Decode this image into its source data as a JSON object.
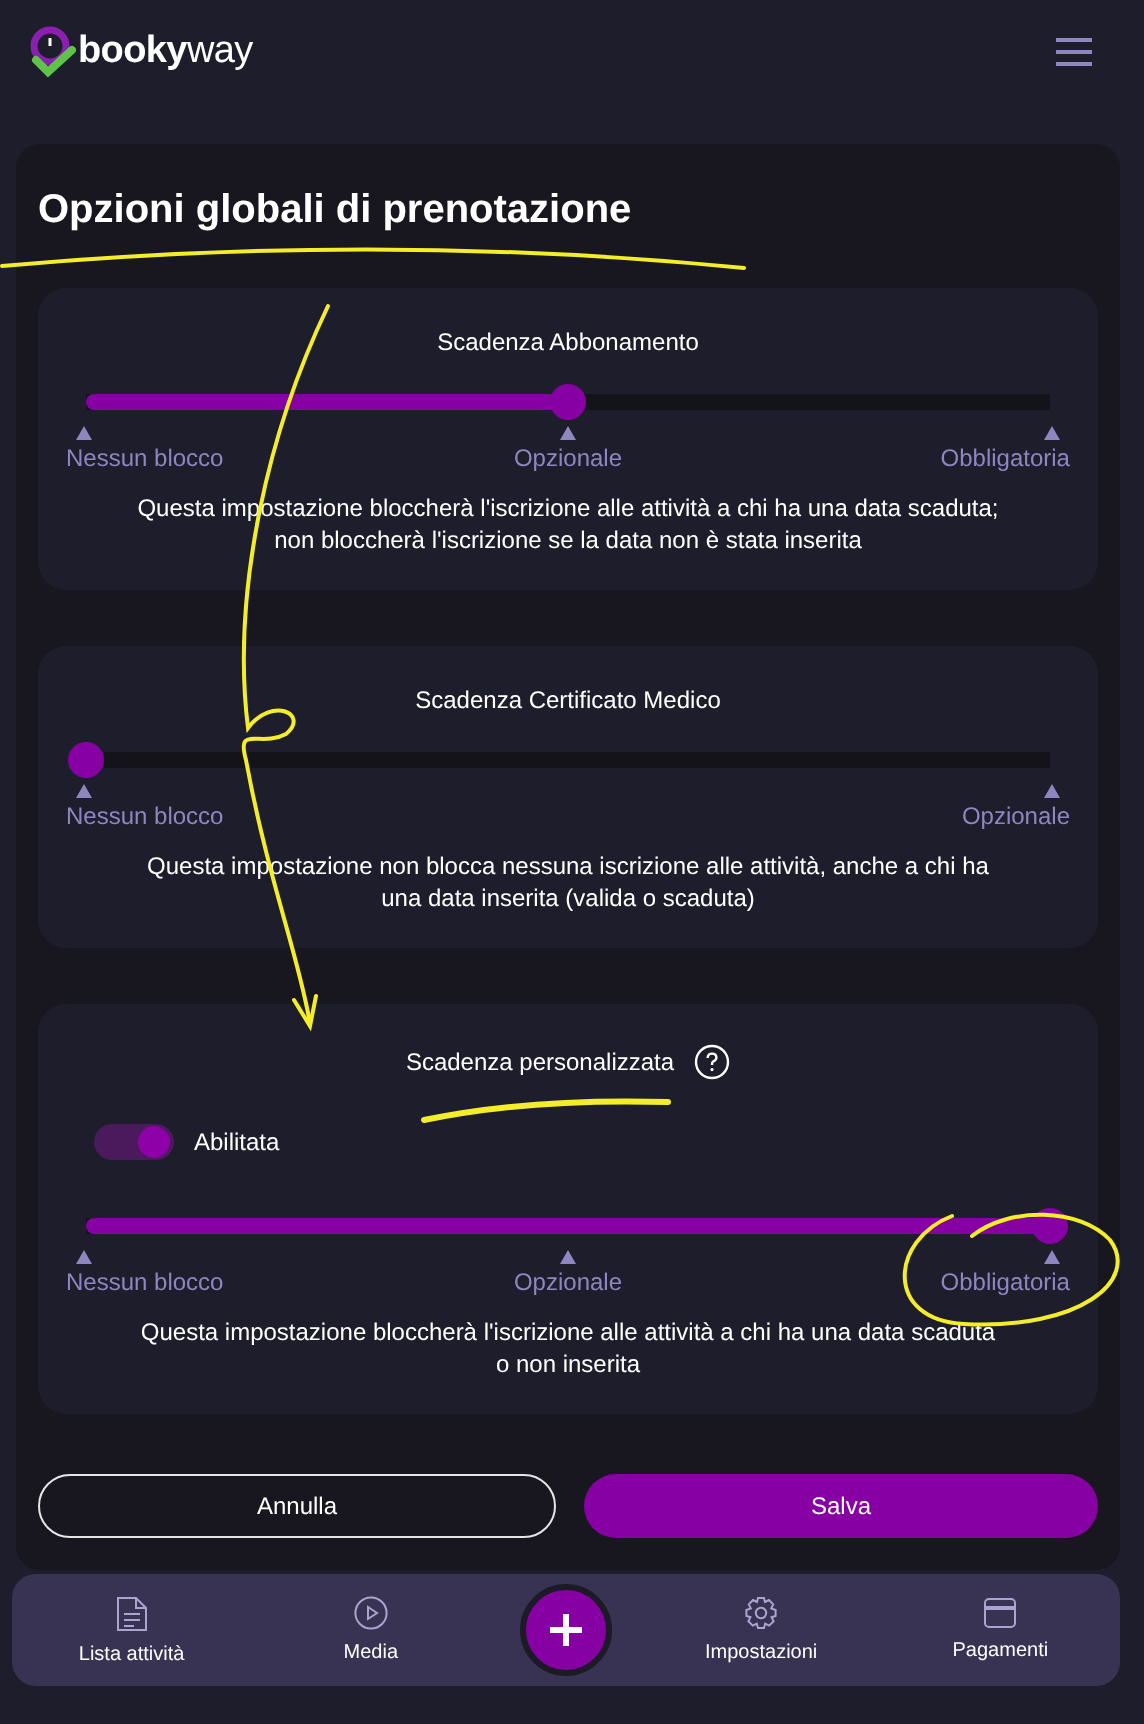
{
  "header": {
    "logo": "**booky**way"
  },
  "page_title": "Opzioni globali di prenotazione",
  "sections": [
    {
      "title": "Scadenza Abbonamento",
      "slider": {
        "level": 0.5,
        "stops": [
          "Nessun blocco",
          "Opzionale",
          "Obbligatoria"
        ]
      },
      "description": "Questa impostazione bloccherà l'iscrizione alle attività a chi ha una data scaduta;\nnon bloccherà l'iscrizione se la data non è stata inserita"
    },
    {
      "title": "Scadenza Certificato Medico",
      "slider": {
        "level": 0,
        "stops": [
          "Nessun blocco",
          "Opzionale"
        ]
      },
      "description": "Questa impostazione non blocca nessuna iscrizione alle attività, anche a chi ha\nuna data inserita (valida o scaduta)"
    },
    {
      "title": "Scadenza personalizzata",
      "help_icon": true,
      "toggle": {
        "label": "Abilitata",
        "on": true
      },
      "slider": {
        "level": 1,
        "stops": [
          "Nessun blocco",
          "Opzionale",
          "Obbligatoria"
        ]
      },
      "description": "Questa impostazione bloccherà l'iscrizione alle attività a chi ha una data scaduta\no non inserita"
    }
  ],
  "buttons": [
    {
      "label": "Annulla",
      "kind": "secondary"
    },
    {
      "label": "Salva",
      "kind": "primary"
    }
  ],
  "bottom_nav": [
    {
      "kind": "document",
      "label": "Lista attività"
    },
    {
      "kind": "play",
      "label": "Media"
    },
    {
      "kind": "add"
    },
    {
      "kind": "gear",
      "label": "Impostazioni"
    },
    {
      "kind": "card",
      "label": "Pagamenti"
    }
  ]
}
